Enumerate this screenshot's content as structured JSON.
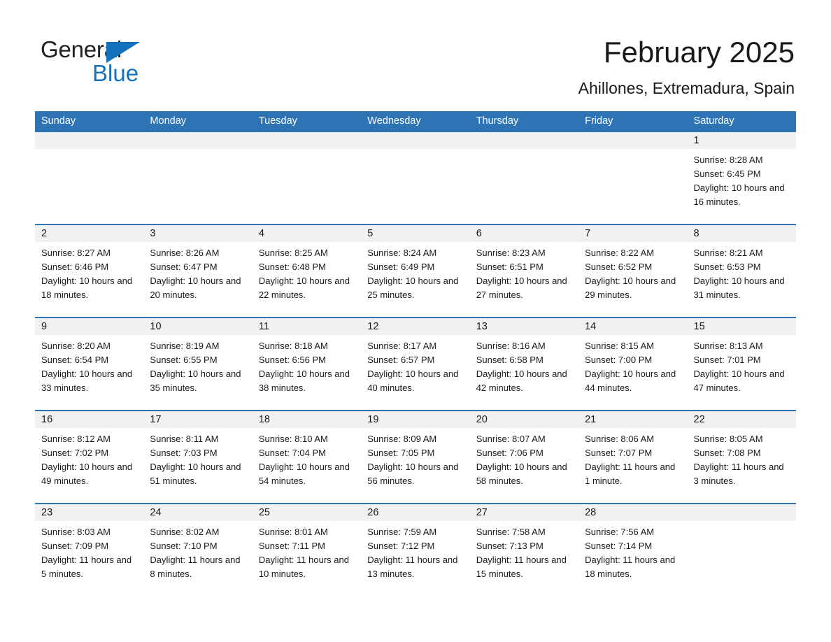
{
  "brand": {
    "word1": "General",
    "word2": "Blue",
    "triangle_color": "#1472bd"
  },
  "header": {
    "title": "February 2025",
    "subtitle": "Ahillones, Extremadura, Spain"
  },
  "theme": {
    "header_blue": "#2e74b5",
    "day_strip_gray": "#f1f1f1",
    "text": "#1a1a1a"
  },
  "weekdays": [
    "Sunday",
    "Monday",
    "Tuesday",
    "Wednesday",
    "Thursday",
    "Friday",
    "Saturday"
  ],
  "weeks": [
    [
      {
        "date": "",
        "sunrise": "",
        "sunset": "",
        "daylight": ""
      },
      {
        "date": "",
        "sunrise": "",
        "sunset": "",
        "daylight": ""
      },
      {
        "date": "",
        "sunrise": "",
        "sunset": "",
        "daylight": ""
      },
      {
        "date": "",
        "sunrise": "",
        "sunset": "",
        "daylight": ""
      },
      {
        "date": "",
        "sunrise": "",
        "sunset": "",
        "daylight": ""
      },
      {
        "date": "",
        "sunrise": "",
        "sunset": "",
        "daylight": ""
      },
      {
        "date": "1",
        "sunrise": "Sunrise: 8:28 AM",
        "sunset": "Sunset: 6:45 PM",
        "daylight": "Daylight: 10 hours and 16 minutes."
      }
    ],
    [
      {
        "date": "2",
        "sunrise": "Sunrise: 8:27 AM",
        "sunset": "Sunset: 6:46 PM",
        "daylight": "Daylight: 10 hours and 18 minutes."
      },
      {
        "date": "3",
        "sunrise": "Sunrise: 8:26 AM",
        "sunset": "Sunset: 6:47 PM",
        "daylight": "Daylight: 10 hours and 20 minutes."
      },
      {
        "date": "4",
        "sunrise": "Sunrise: 8:25 AM",
        "sunset": "Sunset: 6:48 PM",
        "daylight": "Daylight: 10 hours and 22 minutes."
      },
      {
        "date": "5",
        "sunrise": "Sunrise: 8:24 AM",
        "sunset": "Sunset: 6:49 PM",
        "daylight": "Daylight: 10 hours and 25 minutes."
      },
      {
        "date": "6",
        "sunrise": "Sunrise: 8:23 AM",
        "sunset": "Sunset: 6:51 PM",
        "daylight": "Daylight: 10 hours and 27 minutes."
      },
      {
        "date": "7",
        "sunrise": "Sunrise: 8:22 AM",
        "sunset": "Sunset: 6:52 PM",
        "daylight": "Daylight: 10 hours and 29 minutes."
      },
      {
        "date": "8",
        "sunrise": "Sunrise: 8:21 AM",
        "sunset": "Sunset: 6:53 PM",
        "daylight": "Daylight: 10 hours and 31 minutes."
      }
    ],
    [
      {
        "date": "9",
        "sunrise": "Sunrise: 8:20 AM",
        "sunset": "Sunset: 6:54 PM",
        "daylight": "Daylight: 10 hours and 33 minutes."
      },
      {
        "date": "10",
        "sunrise": "Sunrise: 8:19 AM",
        "sunset": "Sunset: 6:55 PM",
        "daylight": "Daylight: 10 hours and 35 minutes."
      },
      {
        "date": "11",
        "sunrise": "Sunrise: 8:18 AM",
        "sunset": "Sunset: 6:56 PM",
        "daylight": "Daylight: 10 hours and 38 minutes."
      },
      {
        "date": "12",
        "sunrise": "Sunrise: 8:17 AM",
        "sunset": "Sunset: 6:57 PM",
        "daylight": "Daylight: 10 hours and 40 minutes."
      },
      {
        "date": "13",
        "sunrise": "Sunrise: 8:16 AM",
        "sunset": "Sunset: 6:58 PM",
        "daylight": "Daylight: 10 hours and 42 minutes."
      },
      {
        "date": "14",
        "sunrise": "Sunrise: 8:15 AM",
        "sunset": "Sunset: 7:00 PM",
        "daylight": "Daylight: 10 hours and 44 minutes."
      },
      {
        "date": "15",
        "sunrise": "Sunrise: 8:13 AM",
        "sunset": "Sunset: 7:01 PM",
        "daylight": "Daylight: 10 hours and 47 minutes."
      }
    ],
    [
      {
        "date": "16",
        "sunrise": "Sunrise: 8:12 AM",
        "sunset": "Sunset: 7:02 PM",
        "daylight": "Daylight: 10 hours and 49 minutes."
      },
      {
        "date": "17",
        "sunrise": "Sunrise: 8:11 AM",
        "sunset": "Sunset: 7:03 PM",
        "daylight": "Daylight: 10 hours and 51 minutes."
      },
      {
        "date": "18",
        "sunrise": "Sunrise: 8:10 AM",
        "sunset": "Sunset: 7:04 PM",
        "daylight": "Daylight: 10 hours and 54 minutes."
      },
      {
        "date": "19",
        "sunrise": "Sunrise: 8:09 AM",
        "sunset": "Sunset: 7:05 PM",
        "daylight": "Daylight: 10 hours and 56 minutes."
      },
      {
        "date": "20",
        "sunrise": "Sunrise: 8:07 AM",
        "sunset": "Sunset: 7:06 PM",
        "daylight": "Daylight: 10 hours and 58 minutes."
      },
      {
        "date": "21",
        "sunrise": "Sunrise: 8:06 AM",
        "sunset": "Sunset: 7:07 PM",
        "daylight": "Daylight: 11 hours and 1 minute."
      },
      {
        "date": "22",
        "sunrise": "Sunrise: 8:05 AM",
        "sunset": "Sunset: 7:08 PM",
        "daylight": "Daylight: 11 hours and 3 minutes."
      }
    ],
    [
      {
        "date": "23",
        "sunrise": "Sunrise: 8:03 AM",
        "sunset": "Sunset: 7:09 PM",
        "daylight": "Daylight: 11 hours and 5 minutes."
      },
      {
        "date": "24",
        "sunrise": "Sunrise: 8:02 AM",
        "sunset": "Sunset: 7:10 PM",
        "daylight": "Daylight: 11 hours and 8 minutes."
      },
      {
        "date": "25",
        "sunrise": "Sunrise: 8:01 AM",
        "sunset": "Sunset: 7:11 PM",
        "daylight": "Daylight: 11 hours and 10 minutes."
      },
      {
        "date": "26",
        "sunrise": "Sunrise: 7:59 AM",
        "sunset": "Sunset: 7:12 PM",
        "daylight": "Daylight: 11 hours and 13 minutes."
      },
      {
        "date": "27",
        "sunrise": "Sunrise: 7:58 AM",
        "sunset": "Sunset: 7:13 PM",
        "daylight": "Daylight: 11 hours and 15 minutes."
      },
      {
        "date": "28",
        "sunrise": "Sunrise: 7:56 AM",
        "sunset": "Sunset: 7:14 PM",
        "daylight": "Daylight: 11 hours and 18 minutes."
      },
      {
        "date": "",
        "sunrise": "",
        "sunset": "",
        "daylight": ""
      }
    ]
  ]
}
